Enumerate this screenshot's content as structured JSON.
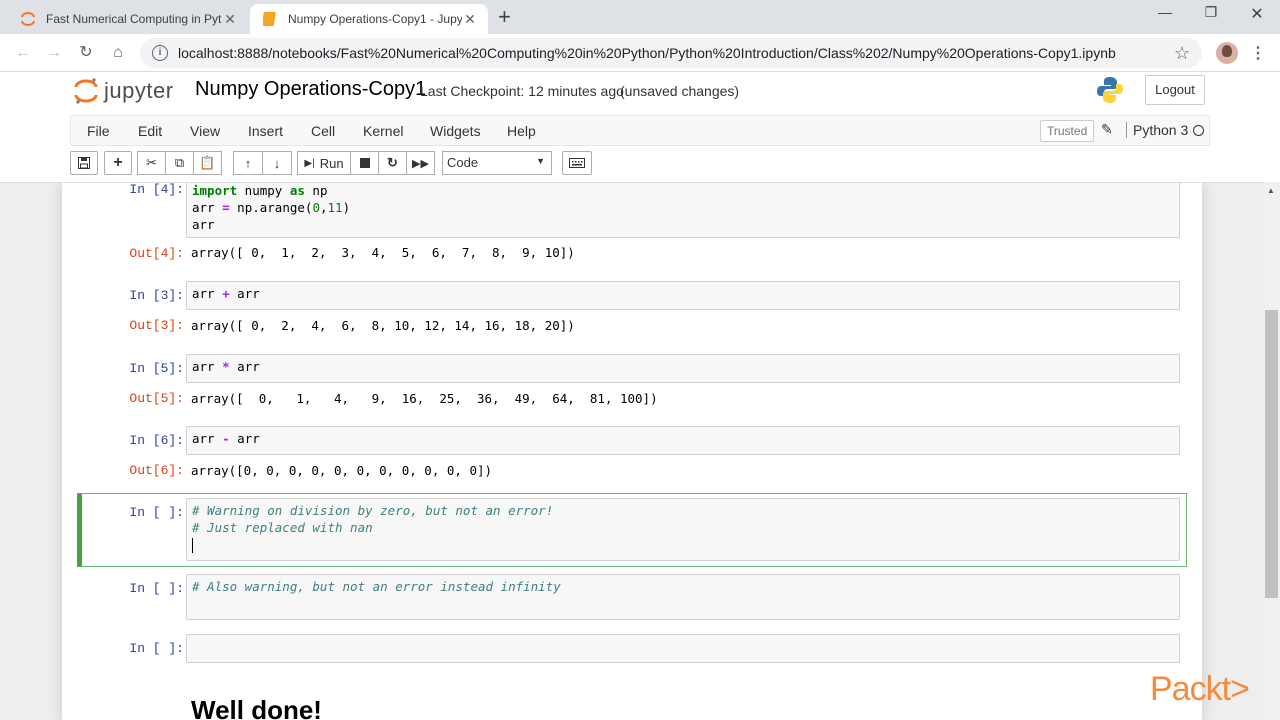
{
  "browser": {
    "tabs": [
      {
        "title": "Fast Numerical Computing in Pyt",
        "active": false
      },
      {
        "title": "Numpy Operations-Copy1 - Jupy",
        "active": true
      }
    ],
    "url": "localhost:8888/notebooks/Fast%20Numerical%20Computing%20in%20Python/Python%20Introduction/Class%202/Numpy%20Operations-Copy1.ipynb"
  },
  "jupyter": {
    "logo_text": "jupyter",
    "notebook_title": "Numpy Operations-Copy1",
    "checkpoint": "Last Checkpoint: 12 minutes ago",
    "save_status": "(unsaved changes)",
    "logout_label": "Logout",
    "menu": [
      "File",
      "Edit",
      "View",
      "Insert",
      "Cell",
      "Kernel",
      "Widgets",
      "Help"
    ],
    "trusted_label": "Trusted",
    "kernel_name": "Python 3",
    "run_label": "Run",
    "cell_type": "Code"
  },
  "cells": [
    {
      "prompt": "In [4]:",
      "out_prompt": "Out[4]:",
      "output": "array([ 0,  1,  2,  3,  4,  5,  6,  7,  8,  9, 10])"
    },
    {
      "prompt": "In [3]:",
      "out_prompt": "Out[3]:",
      "output": "array([ 0,  2,  4,  6,  8, 10, 12, 14, 16, 18, 20])"
    },
    {
      "prompt": "In [5]:",
      "out_prompt": "Out[5]:",
      "output": "array([  0,   1,   4,   9,  16,  25,  36,  49,  64,  81, 100])"
    },
    {
      "prompt": "In [6]:",
      "out_prompt": "Out[6]:",
      "output": "array([0, 0, 0, 0, 0, 0, 0, 0, 0, 0, 0])"
    },
    {
      "prompt": "In [ ]:",
      "comment1": "# Warning on division by zero, but not an error!",
      "comment2": "# Just replaced with nan"
    },
    {
      "prompt": "In [ ]:",
      "comment1": "# Also warning, but not an error instead infinity"
    },
    {
      "prompt": "In [ ]:"
    }
  ],
  "code": {
    "c4_l1_kw": "import",
    "c4_l1_a": " numpy ",
    "c4_l1_kw2": "as",
    "c4_l1_b": " np",
    "c4_l2_a": "arr ",
    "c4_l2_op": "=",
    "c4_l2_b": " np.arange(",
    "c4_l2_n1": "0",
    "c4_l2_c": ",",
    "c4_l2_n2": "11",
    "c4_l2_d": ")",
    "c4_l3": "arr",
    "c3_a": "arr ",
    "c3_op": "+",
    "c3_b": " arr",
    "c5_a": "arr ",
    "c5_op": "*",
    "c5_b": " arr",
    "c6_a": "arr ",
    "c6_op": "-",
    "c6_b": " arr"
  },
  "markdown_heading": "Well done!",
  "watermark": "Packt>"
}
